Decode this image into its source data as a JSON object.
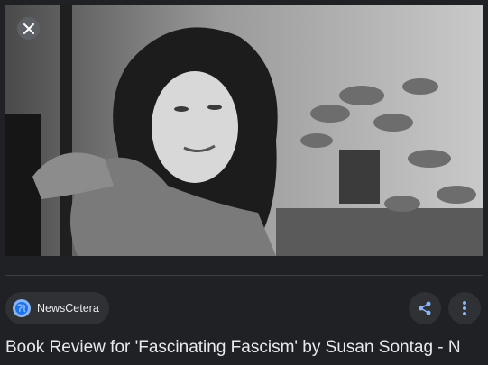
{
  "image": {
    "alt": "Black and white photo of a woman seated by a window with a potted plant"
  },
  "source": {
    "name": "NewsCetera",
    "icon": "globe-icon"
  },
  "actions": {
    "close_icon": "close-icon",
    "share_icon": "share-icon",
    "more_icon": "more-vert-icon"
  },
  "result": {
    "title": "Book Review for 'Fascinating Fascism' by Susan Sontag - N"
  },
  "colors": {
    "background": "#202124",
    "chip": "#303134",
    "accent": "#8ab4f8",
    "text": "#e8eaed"
  }
}
